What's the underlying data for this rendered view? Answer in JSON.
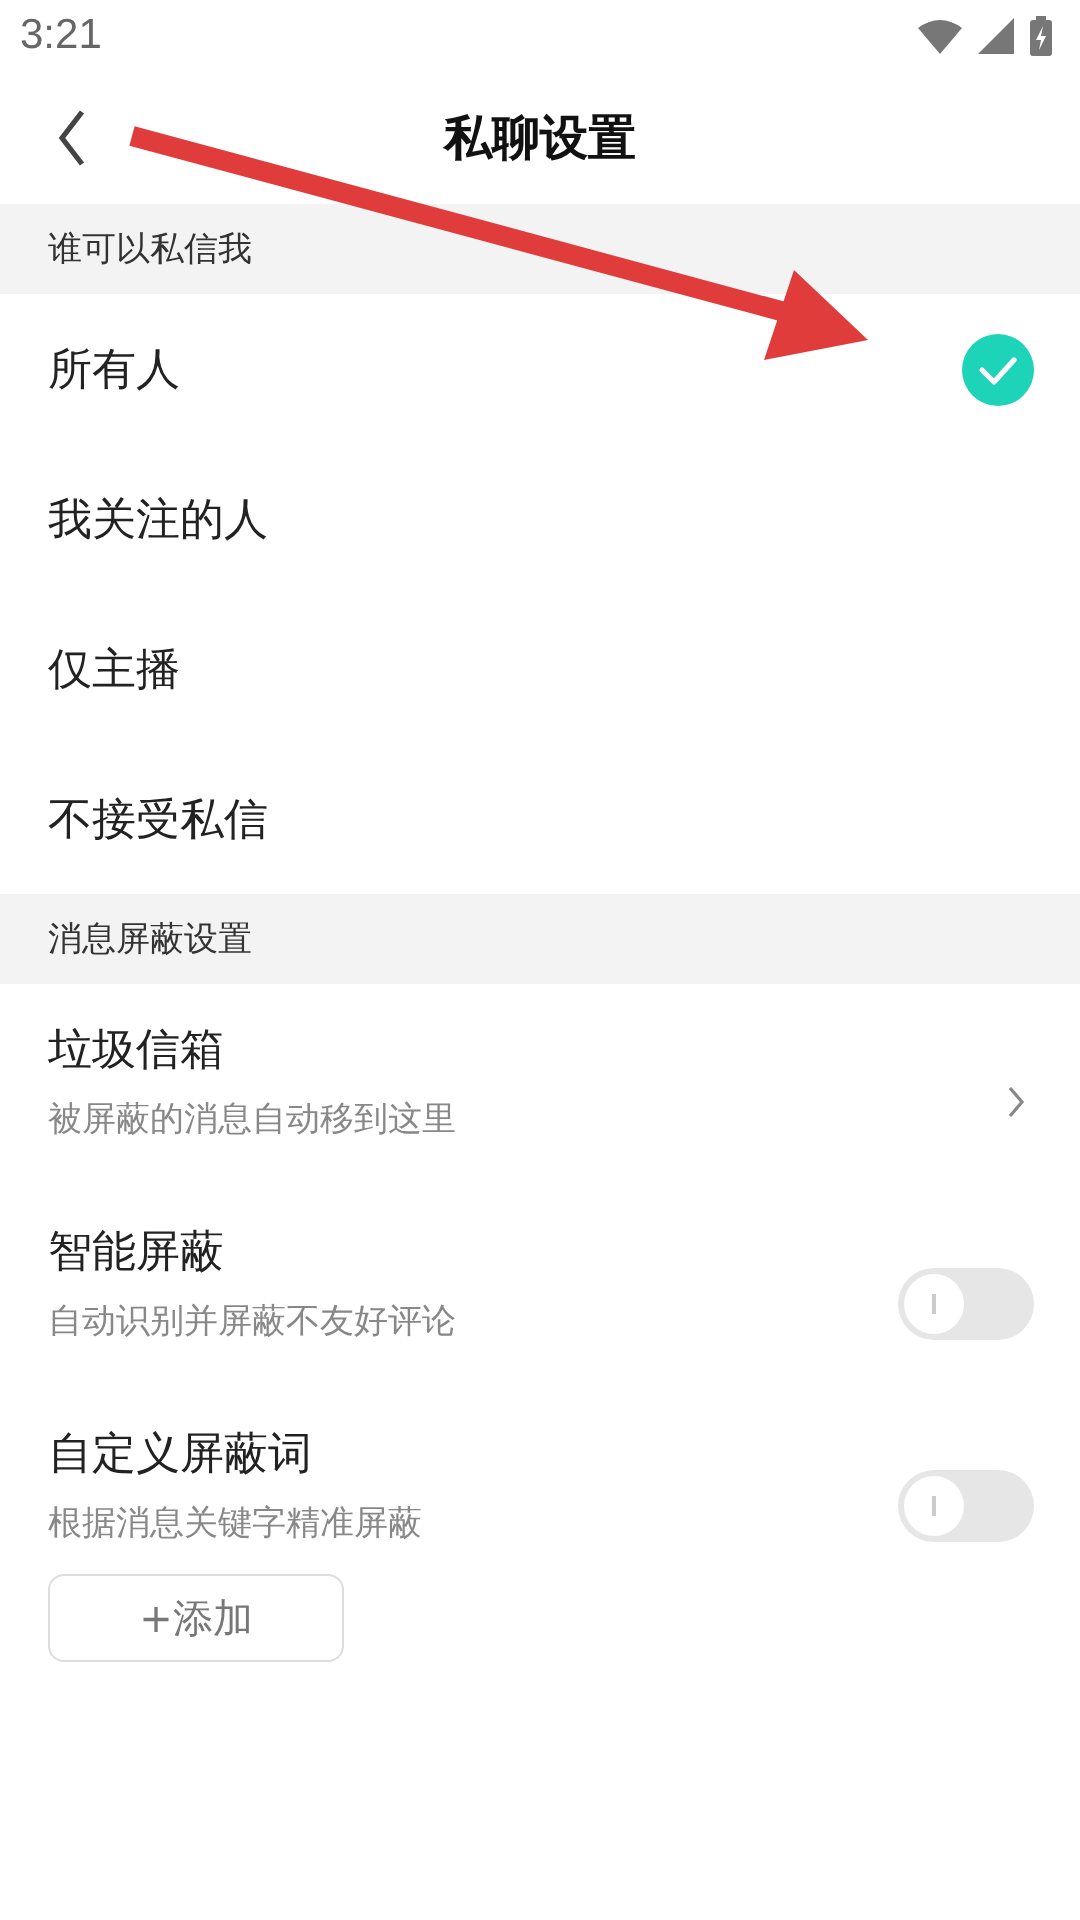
{
  "status_bar": {
    "time": "3:21"
  },
  "header": {
    "title": "私聊设置"
  },
  "sections": [
    {
      "title": "谁可以私信我",
      "kind": "choices",
      "items": [
        {
          "label": "所有人",
          "selected": true
        },
        {
          "label": "我关注的人",
          "selected": false
        },
        {
          "label": "仅主播",
          "selected": false
        },
        {
          "label": "不接受私信",
          "selected": false
        }
      ]
    },
    {
      "title": "消息屏蔽设置",
      "kind": "settings",
      "items": [
        {
          "kind": "link",
          "label": "垃圾信箱",
          "description": "被屏蔽的消息自动移到这里"
        },
        {
          "kind": "toggle",
          "label": "智能屏蔽",
          "description": "自动识别并屏蔽不友好评论",
          "on": false
        },
        {
          "kind": "toggle",
          "label": "自定义屏蔽词",
          "description": "根据消息关键字精准屏蔽",
          "on": false,
          "button": "+添加"
        }
      ]
    }
  ]
}
